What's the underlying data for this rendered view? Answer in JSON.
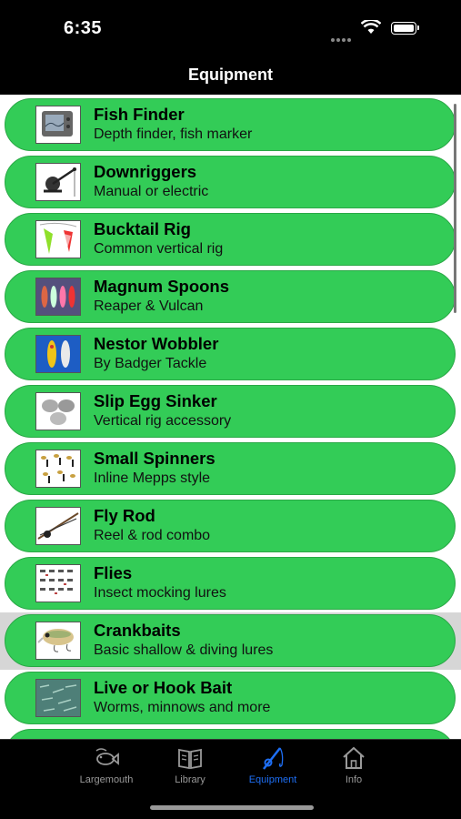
{
  "status": {
    "time": "6:35"
  },
  "nav": {
    "title": "Equipment"
  },
  "items": [
    {
      "title": "Fish Finder",
      "subtitle": "Depth finder, fish marker",
      "icon": "fish-finder-device"
    },
    {
      "title": "Downriggers",
      "subtitle": "Manual or electric",
      "icon": "downrigger"
    },
    {
      "title": "Bucktail Rig",
      "subtitle": "Common vertical rig",
      "icon": "bucktail-rig"
    },
    {
      "title": "Magnum Spoons",
      "subtitle": "Reaper & Vulcan",
      "icon": "spoons"
    },
    {
      "title": "Nestor Wobbler",
      "subtitle": "By Badger Tackle",
      "icon": "wobbler"
    },
    {
      "title": "Slip Egg Sinker",
      "subtitle": "Vertical rig accessory",
      "icon": "egg-sinker"
    },
    {
      "title": "Small Spinners",
      "subtitle": "Inline Mepps style",
      "icon": "spinners"
    },
    {
      "title": "Fly Rod",
      "subtitle": "Reel & rod combo",
      "icon": "fly-rod"
    },
    {
      "title": "Flies",
      "subtitle": "Insect mocking lures",
      "icon": "flies"
    },
    {
      "title": "Crankbaits",
      "subtitle": "Basic shallow & diving lures",
      "icon": "crankbait"
    },
    {
      "title": "Live or Hook Bait",
      "subtitle": "Worms, minnows and more",
      "icon": "live-bait"
    }
  ],
  "selected_index": 9,
  "tabs": [
    {
      "label": "Largemouth",
      "icon": "fish-icon",
      "active": false
    },
    {
      "label": "Library",
      "icon": "book-icon",
      "active": false
    },
    {
      "label": "Equipment",
      "icon": "rod-icon",
      "active": true
    },
    {
      "label": "Info",
      "icon": "house-icon",
      "active": false
    }
  ],
  "colors": {
    "pill_green": "#33cc57",
    "tab_active": "#1e6ff5",
    "tab_inactive": "#999999"
  }
}
